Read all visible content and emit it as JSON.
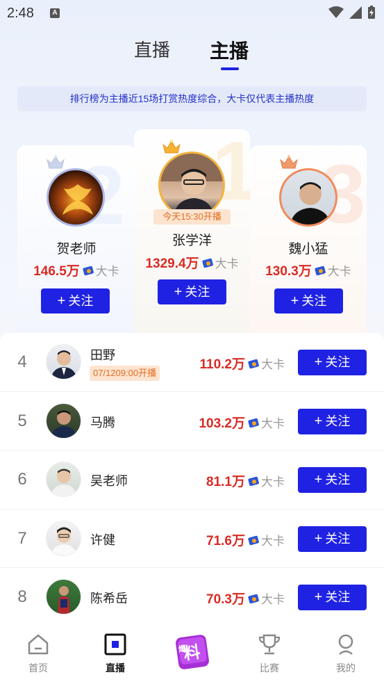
{
  "status_bar": {
    "time": "2:48",
    "notification_icon_letter": "A"
  },
  "tabs": {
    "live": "直播",
    "host": "主播",
    "active": "host"
  },
  "notice": "排行榜为主播近15场打赏热度综合，大卡仅代表主播热度",
  "podium": {
    "first": {
      "rank": "1",
      "name": "张学洋",
      "score": "1329.4万",
      "unit": "大卡",
      "live_tag": "今天15:30开播",
      "follow": "关注"
    },
    "second": {
      "rank": "2",
      "name": "贺老师",
      "score": "146.5万",
      "unit": "大卡",
      "follow": "关注"
    },
    "third": {
      "rank": "3",
      "name": "魏小猛",
      "score": "130.3万",
      "unit": "大卡",
      "follow": "关注"
    }
  },
  "list": [
    {
      "rank": "4",
      "name": "田野",
      "tag": "07/1209:00开播",
      "score": "110.2万",
      "unit": "大卡",
      "follow": "关注"
    },
    {
      "rank": "5",
      "name": "马腾",
      "score": "103.2万",
      "unit": "大卡",
      "follow": "关注"
    },
    {
      "rank": "6",
      "name": "吴老师",
      "score": "81.1万",
      "unit": "大卡",
      "follow": "关注"
    },
    {
      "rank": "7",
      "name": "许健",
      "score": "71.6万",
      "unit": "大卡",
      "follow": "关注"
    },
    {
      "rank": "8",
      "name": "陈希岳",
      "score": "70.3万",
      "unit": "大卡",
      "follow": "关注"
    }
  ],
  "bottom_nav": [
    {
      "label": "首页",
      "icon": "home-icon"
    },
    {
      "label": "直播",
      "icon": "live-icon",
      "active": true
    },
    {
      "label": "爆料",
      "icon": "baoliao-icon"
    },
    {
      "label": "比赛",
      "icon": "trophy-icon"
    },
    {
      "label": "我的",
      "icon": "profile-icon"
    }
  ],
  "colors": {
    "accent": "#1f22e2",
    "score_red": "#d92a24",
    "tag_orange": "#e46a20"
  }
}
